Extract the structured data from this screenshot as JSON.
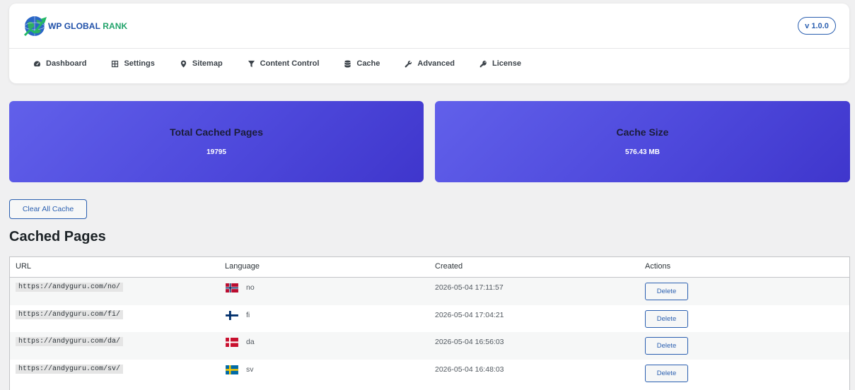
{
  "brand": {
    "name_part1": "WP GLOBAL",
    "name_part2": "RANK",
    "logo_icon": "globe-chart-logo"
  },
  "version_badge": "v 1.0.0",
  "nav": [
    {
      "label": "Dashboard",
      "icon": "gauge-icon"
    },
    {
      "label": "Settings",
      "icon": "grid-icon"
    },
    {
      "label": "Sitemap",
      "icon": "map-pin-icon"
    },
    {
      "label": "Content Control",
      "icon": "filter-icon"
    },
    {
      "label": "Cache",
      "icon": "database-icon"
    },
    {
      "label": "Advanced",
      "icon": "wrench-icon"
    },
    {
      "label": "License",
      "icon": "key-icon"
    }
  ],
  "stats": {
    "total_cached_pages": {
      "title": "Total Cached Pages",
      "value": "19795"
    },
    "cache_size": {
      "title": "Cache Size",
      "value": "576.43 MB"
    }
  },
  "clear_all_cache_label": "Clear All Cache",
  "section_title": "Cached Pages",
  "table": {
    "columns": [
      "URL",
      "Language",
      "Created",
      "Actions"
    ],
    "rows": [
      {
        "url": "https://andyguru.com/no/",
        "lang": "no",
        "flag": "norway-flag",
        "created": "2026-05-04 17:11:57",
        "action": "Delete"
      },
      {
        "url": "https://andyguru.com/fi/",
        "lang": "fi",
        "flag": "finland-flag",
        "created": "2026-05-04 17:04:21",
        "action": "Delete"
      },
      {
        "url": "https://andyguru.com/da/",
        "lang": "da",
        "flag": "denmark-flag",
        "created": "2026-05-04 16:56:03",
        "action": "Delete"
      },
      {
        "url": "https://andyguru.com/sv/",
        "lang": "sv",
        "flag": "sweden-flag",
        "created": "2026-05-04 16:48:03",
        "action": "Delete"
      }
    ]
  },
  "colors": {
    "accent": "#2a5fb0",
    "card_gradient_start": "#6160ea",
    "card_gradient_end": "#3f36cc",
    "brand_green": "#22a36b"
  }
}
